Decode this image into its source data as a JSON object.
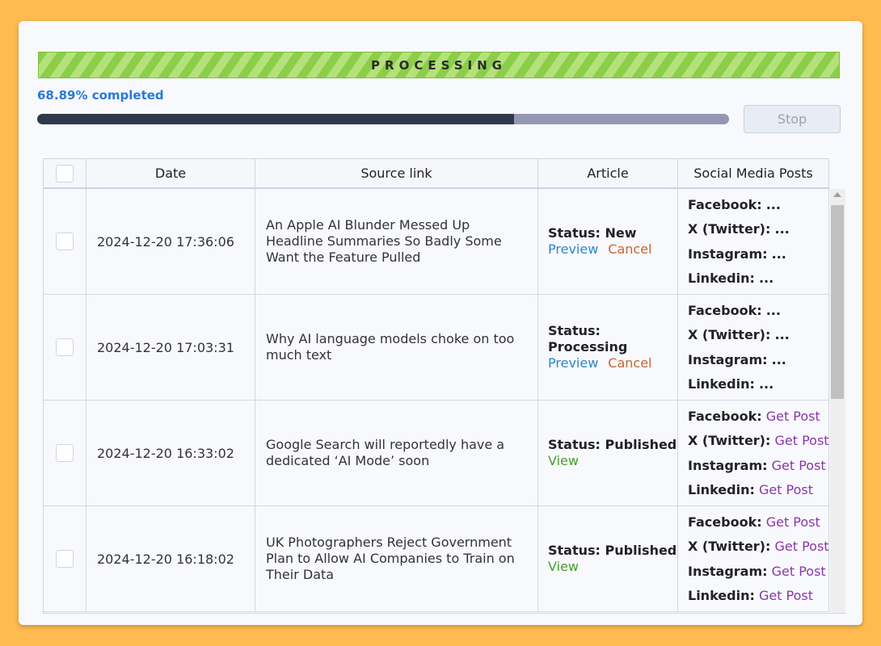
{
  "banner": {
    "label": "PROCESSING"
  },
  "progress": {
    "text": "68.89% completed",
    "value": 68.89
  },
  "controls": {
    "stop_label": "Stop"
  },
  "table": {
    "headers": {
      "date": "Date",
      "source": "Source link",
      "article": "Article",
      "social": "Social Media Posts"
    },
    "rows": [
      {
        "date": "2024-12-20 17:36:06",
        "source": "An Apple AI Blunder Messed Up Headline Summaries So Badly Some Want the Feature Pulled",
        "status": "Status: New",
        "actions": {
          "preview": "Preview",
          "cancel": "Cancel"
        },
        "social": {
          "facebook": "...",
          "twitter": "...",
          "instagram": "...",
          "linkedin": "..."
        }
      },
      {
        "date": "2024-12-20 17:03:31",
        "source": "Why AI language models choke on too much text",
        "status": "Status: Processing",
        "actions": {
          "preview": "Preview",
          "cancel": "Cancel"
        },
        "social": {
          "facebook": "...",
          "twitter": "...",
          "instagram": "...",
          "linkedin": "..."
        }
      },
      {
        "date": "2024-12-20 16:33:02",
        "source": "Google Search will reportedly have a dedicated ‘AI Mode’ soon",
        "status": "Status: Published",
        "actions": {
          "view": "View"
        },
        "social": {
          "facebook": "Get Post",
          "twitter": "Get Post",
          "instagram": "Get Post",
          "linkedin": "Get Post"
        }
      },
      {
        "date": "2024-12-20 16:18:02",
        "source": "UK Photographers Reject Government Plan to Allow AI Companies to Train on Their Data",
        "status": "Status: Published",
        "actions": {
          "view": "View"
        },
        "social": {
          "facebook": "Get Post",
          "twitter": "Get Post",
          "instagram": "Get Post",
          "linkedin": "Get Post"
        }
      }
    ]
  },
  "social_labels": {
    "facebook": "Facebook:",
    "twitter": "X (Twitter):",
    "instagram": "Instagram:",
    "linkedin": "Linkedin:"
  },
  "colors": {
    "background": "#ffbb4f",
    "progress_fill": "#2c3a4b",
    "progress_track": "#9497b3",
    "percent_text": "#2979d8",
    "preview_link": "#2b86c9",
    "cancel_link": "#c9642e",
    "view_link": "#479d2f",
    "get_post_link": "#8b36a8"
  }
}
